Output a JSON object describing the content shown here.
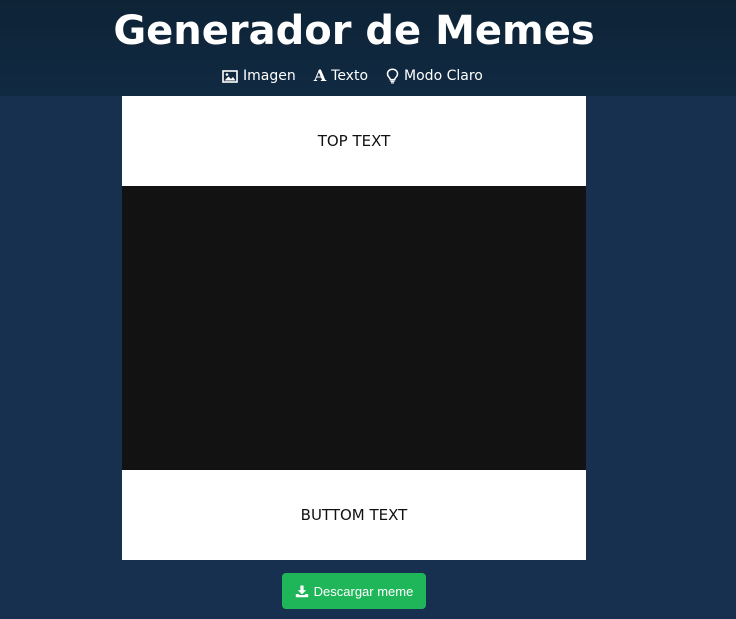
{
  "header": {
    "title": "Generador de Memes",
    "nav": [
      {
        "label": "Imagen",
        "icon": "image-icon"
      },
      {
        "label": "Texto",
        "icon": "text-icon"
      },
      {
        "label": "Modo Claro",
        "icon": "lightbulb-icon"
      }
    ]
  },
  "meme": {
    "top_text": "TOP TEXT",
    "bottom_text": "BUTTOM TEXT"
  },
  "actions": {
    "download_label": "Descargar meme",
    "download_icon": "download-icon"
  },
  "colors": {
    "background": "#173050",
    "header": "#102a42",
    "button": "#1fb65a",
    "meme_image": "#121212"
  }
}
